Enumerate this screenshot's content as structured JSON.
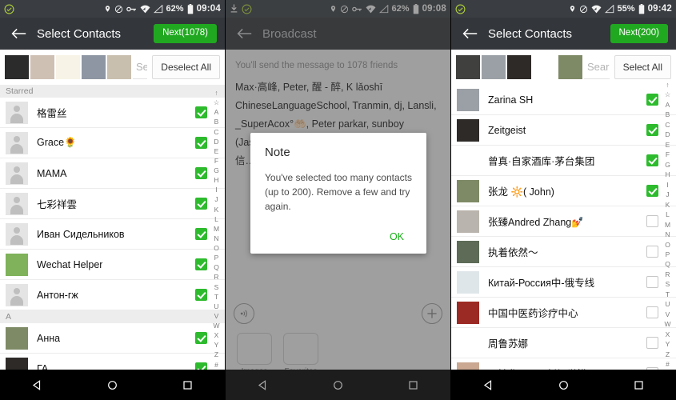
{
  "screens": [
    {
      "id": "select-contacts-1078",
      "statusbar": {
        "icons": [
          "location-icon",
          "do-not-disturb-icon",
          "vpn-key-icon",
          "wifi-icon",
          "signal-icon"
        ],
        "battery": "62%",
        "time": "09:04"
      },
      "actionbar": {
        "back": "back-arrow-icon",
        "title": "Select Contacts",
        "button": "Next(1078)"
      },
      "search": {
        "placeholder": "Search",
        "action": "Deselect All"
      },
      "section_starred": "Starred",
      "section_a": "A",
      "contacts": [
        {
          "name": "格雷丝",
          "checked": true,
          "avatar": "placeholder"
        },
        {
          "name": "Grace🌻",
          "checked": true,
          "avatar": "placeholder"
        },
        {
          "name": "MAMA",
          "checked": true,
          "avatar": "placeholder"
        },
        {
          "name": "七彩祥雲",
          "checked": true,
          "avatar": "placeholder"
        },
        {
          "name": "Иван Сидельников",
          "checked": true,
          "avatar": "placeholder"
        },
        {
          "name": "Wechat Helper",
          "checked": true,
          "avatar": "wechat-helper"
        },
        {
          "name": "Антон-гж",
          "checked": true,
          "avatar": "placeholder"
        }
      ],
      "contacts_a": [
        {
          "name": "Анна",
          "checked": true,
          "avatar": "photo"
        },
        {
          "name": "ГА…",
          "checked": true,
          "avatar": "photo"
        }
      ],
      "index": [
        "↑",
        "☆",
        "A",
        "B",
        "C",
        "D",
        "E",
        "F",
        "G",
        "H",
        "I",
        "J",
        "K",
        "L",
        "M",
        "N",
        "O",
        "P",
        "Q",
        "R",
        "S",
        "T",
        "U",
        "V",
        "W",
        "X",
        "Y",
        "Z",
        "#"
      ]
    },
    {
      "id": "broadcast",
      "statusbar": {
        "icons": [
          "download-icon",
          "check-circle-icon",
          "location-icon",
          "do-not-disturb-icon",
          "vpn-key-icon",
          "wifi-icon",
          "signal-icon"
        ],
        "battery": "62%",
        "time": "09:08"
      },
      "actionbar": {
        "back": "back-arrow-icon",
        "title": "Broadcast"
      },
      "note": "You'll send the message to 1078 friends",
      "recipients": "Max·高峰, Peter, 醒 - 醉, K lǎoshī ChineseLanguageSchool, Tranmin, dj, Lansli, _SuperAcox°🤲🏻, Peter parkar, sunboy (Jason), Jacob雅阁国际, Molly🐻, Ale… 微信…",
      "tools": {
        "voice": "voice-icon",
        "add": "plus-icon"
      },
      "tiles": [
        {
          "label": "Images",
          "icon": "image-icon"
        },
        {
          "label": "Favorites",
          "icon": "star-icon"
        }
      ],
      "dialog": {
        "title": "Note",
        "message": "You've selected too many contacts (up to 200). Remove a few and try again.",
        "ok": "OK",
        "ok_color": "#18b018"
      }
    },
    {
      "id": "select-contacts-200",
      "statusbar": {
        "icons": [
          "check-circle-icon",
          "location-icon",
          "do-not-disturb-icon",
          "wifi-icon",
          "signal-icon"
        ],
        "battery": "55%",
        "time": "09:42"
      },
      "actionbar": {
        "back": "back-arrow-icon",
        "title": "Select Contacts",
        "button": "Next(200)"
      },
      "search": {
        "placeholder": "Search",
        "action": "Select All"
      },
      "contacts": [
        {
          "name": "Zarina SH",
          "checked": true,
          "avatar": "photo"
        },
        {
          "name": "Zeitgeist",
          "checked": true,
          "avatar": "photo"
        },
        {
          "name": "曾真·自家酒库·茅台集团",
          "checked": true,
          "avatar": "photo"
        },
        {
          "name": "张龙 🔆( John)",
          "checked": true,
          "avatar": "photo"
        },
        {
          "name": "张臻Andred Zhang💅",
          "checked": false,
          "avatar": "photo"
        },
        {
          "name": "执着依然～",
          "checked": false,
          "avatar": "photo"
        },
        {
          "name": "Китай-Россия中-俄专线",
          "checked": false,
          "avatar": "photo"
        },
        {
          "name": "中国中医药诊疗中心",
          "checked": false,
          "avatar": "photo"
        },
        {
          "name": "周鲁苏娜",
          "checked": false,
          "avatar": "photo"
        },
        {
          "name": "周敏华Claire 新视觉模具Mould",
          "checked": false,
          "avatar": "photo"
        }
      ],
      "index": [
        "↑",
        "☆",
        "A",
        "B",
        "C",
        "D",
        "E",
        "F",
        "G",
        "H",
        "I",
        "J",
        "K",
        "L",
        "M",
        "N",
        "O",
        "P",
        "Q",
        "R",
        "S",
        "T",
        "U",
        "V",
        "W",
        "X",
        "Y",
        "Z",
        "#"
      ]
    }
  ],
  "navbar": {
    "back": "triangle-back-icon",
    "home": "circle-home-icon",
    "recents": "square-recents-icon"
  },
  "colors": {
    "accent": "#21a821",
    "check": "#2dbb2d",
    "actionbar": "#33363a",
    "statusbar": "#3a3e42"
  }
}
